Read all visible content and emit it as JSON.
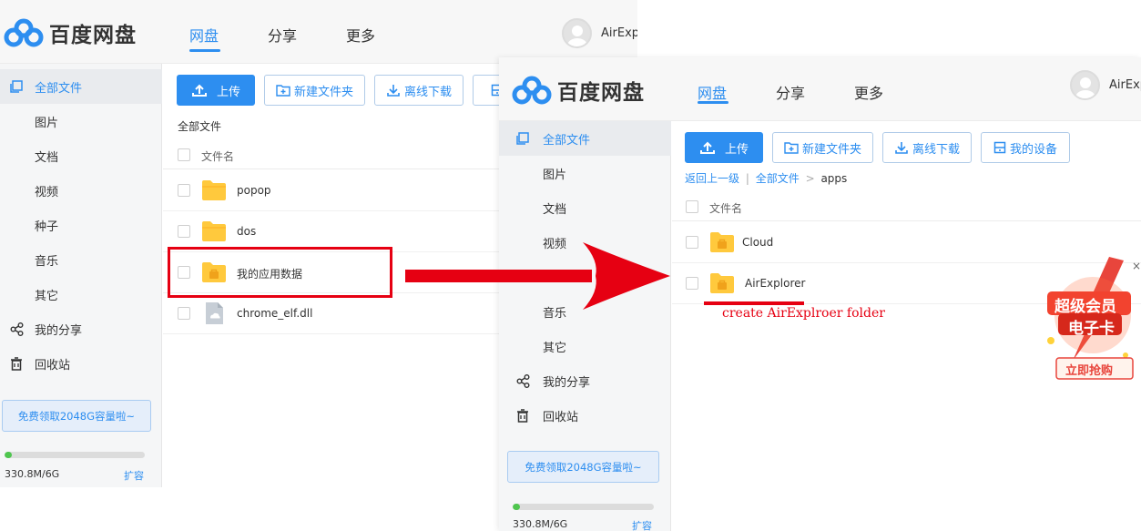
{
  "brand": {
    "name": "百度网盘"
  },
  "colors": {
    "accent": "#2d8ef0",
    "annotation": "#e60012",
    "quota": "#4fc64f",
    "folder": "#ffc93d"
  },
  "nav": [
    "网盘",
    "分享",
    "更多"
  ],
  "user": {
    "name_left": "AirExpl",
    "name_right": "AirExp"
  },
  "sidebar": {
    "items": [
      {
        "label": "全部文件",
        "icon": "files-icon"
      },
      {
        "label": "图片",
        "icon": ""
      },
      {
        "label": "文档",
        "icon": ""
      },
      {
        "label": "视频",
        "icon": ""
      },
      {
        "label": "种子",
        "icon": ""
      },
      {
        "label": "音乐",
        "icon": ""
      },
      {
        "label": "其它",
        "icon": ""
      },
      {
        "label": "我的分享",
        "icon": "share-icon"
      },
      {
        "label": "回收站",
        "icon": "trash-icon"
      }
    ],
    "promo": "免费领取2048G容量啦~",
    "quota": {
      "used": "330.8M/6G",
      "fraction": 0.05,
      "expand": "扩容"
    }
  },
  "toolbar": {
    "upload": "上传",
    "new_folder": "新建文件夹",
    "offline": "离线下载",
    "devices": "我的设备"
  },
  "window1": {
    "breadcrumb": "全部文件",
    "column": "文件名",
    "files": [
      {
        "name": "popop",
        "type": "folder"
      },
      {
        "name": "dos",
        "type": "folder"
      },
      {
        "name": "我的应用数据",
        "type": "app-folder"
      },
      {
        "name": "chrome_elf.dll",
        "type": "file"
      }
    ]
  },
  "window2": {
    "breadcrumb": {
      "back": "返回上一级",
      "root": "全部文件",
      "sep": ">",
      "current": "apps"
    },
    "column": "文件名",
    "files": [
      {
        "name": "Cloud",
        "type": "app-folder"
      },
      {
        "name": "AirExplorer",
        "type": "app-folder"
      }
    ]
  },
  "annotation": "create AirExplroer folder",
  "ad": {
    "line1": "超级会员",
    "line2": "电子卡",
    "cta": "立即抢购",
    "close": "×"
  }
}
